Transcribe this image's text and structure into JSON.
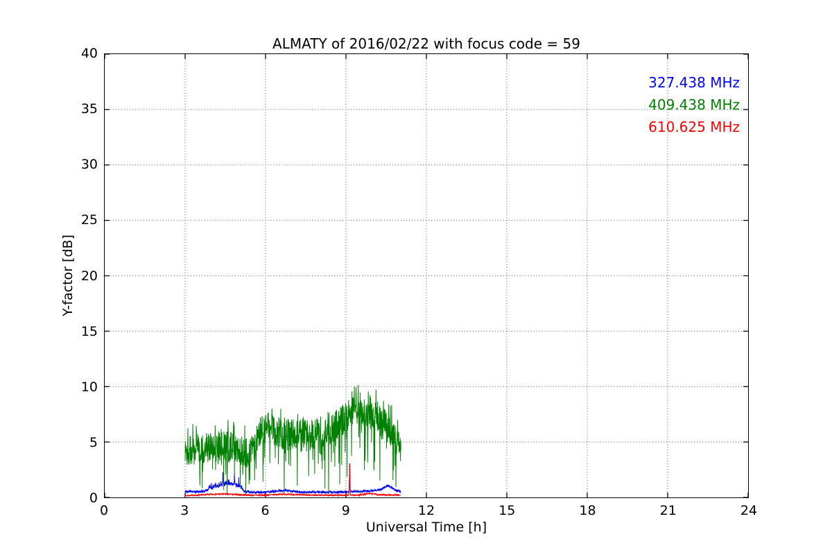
{
  "chart_data": {
    "type": "line",
    "title": "ALMATY of 2016/02/22 with focus code = 59",
    "xlabel": "Universal Time [h]",
    "ylabel": "Y-factor [dB]",
    "xlim": [
      0,
      24
    ],
    "ylim": [
      0,
      40
    ],
    "xticks": [
      0,
      3,
      6,
      9,
      12,
      15,
      18,
      21,
      24
    ],
    "yticks": [
      0,
      5,
      10,
      15,
      20,
      25,
      30,
      35,
      40
    ],
    "grid": "dotted",
    "legend": {
      "position": "upper-right",
      "entries": [
        {
          "label": "327.438 MHz",
          "color": "#0000ff"
        },
        {
          "label": "409.438 MHz",
          "color": "#008000"
        },
        {
          "label": "610.625 MHz",
          "color": "#ff0000"
        }
      ]
    },
    "series": [
      {
        "name": "327.438 MHz",
        "color": "#0000ff",
        "trange": [
          3.0,
          11.05
        ],
        "step": 0.008,
        "seed": 99,
        "noise": 0.22,
        "baseline": [
          [
            3.0,
            0.55
          ],
          [
            3.4,
            0.5
          ],
          [
            3.7,
            0.55
          ],
          [
            3.9,
            0.7
          ],
          [
            4.1,
            0.9
          ],
          [
            4.3,
            1.0
          ],
          [
            4.5,
            1.1
          ],
          [
            4.7,
            1.2
          ],
          [
            4.9,
            1.0
          ],
          [
            5.05,
            0.9
          ],
          [
            5.2,
            0.6
          ],
          [
            5.5,
            0.45
          ],
          [
            6.0,
            0.45
          ],
          [
            6.5,
            0.6
          ],
          [
            6.8,
            0.65
          ],
          [
            7.0,
            0.55
          ],
          [
            7.5,
            0.45
          ],
          [
            8.0,
            0.5
          ],
          [
            8.5,
            0.45
          ],
          [
            9.0,
            0.5
          ],
          [
            9.5,
            0.55
          ],
          [
            10.0,
            0.6
          ],
          [
            10.3,
            0.7
          ],
          [
            10.5,
            1.0
          ],
          [
            10.6,
            1.05
          ],
          [
            10.75,
            0.8
          ],
          [
            10.9,
            0.6
          ],
          [
            11.05,
            0.5
          ]
        ],
        "extra_noise": {
          "trange": [
            3.85,
            5.15
          ],
          "amp": 0.5
        },
        "spikes": [
          [
            3.9,
            1.3
          ],
          [
            4.41,
            2.5
          ],
          [
            4.67,
            1.5
          ],
          [
            4.84,
            2.2
          ],
          [
            5.0,
            1.8
          ],
          [
            9.14,
            3.7
          ]
        ],
        "spike_width": 0.022
      },
      {
        "name": "409.438 MHz",
        "color": "#008000",
        "trange": [
          3.0,
          11.05
        ],
        "step": 0.008,
        "seed": 1337,
        "band": 2.8,
        "dropout_prob": 0.1,
        "upspike_prob": 0.05,
        "ymax": 10.45,
        "center": [
          [
            3.0,
            4.2
          ],
          [
            3.5,
            4.4
          ],
          [
            4.0,
            4.5
          ],
          [
            4.5,
            4.7
          ],
          [
            5.0,
            4.4
          ],
          [
            5.4,
            3.9
          ],
          [
            5.8,
            5.8
          ],
          [
            6.1,
            6.4
          ],
          [
            6.4,
            5.9
          ],
          [
            6.8,
            5.6
          ],
          [
            7.2,
            5.7
          ],
          [
            7.6,
            5.6
          ],
          [
            8.0,
            5.9
          ],
          [
            8.4,
            6.1
          ],
          [
            8.8,
            6.9
          ],
          [
            9.2,
            7.6
          ],
          [
            9.5,
            7.9
          ],
          [
            9.8,
            7.3
          ],
          [
            10.1,
            7.5
          ],
          [
            10.4,
            6.9
          ],
          [
            10.7,
            5.9
          ],
          [
            10.9,
            4.9
          ],
          [
            11.05,
            4.3
          ]
        ]
      },
      {
        "name": "610.625 MHz",
        "color": "#ff0000",
        "trange": [
          3.0,
          11.05
        ],
        "step": 0.008,
        "seed": 7,
        "noise": 0.13,
        "baseline": [
          [
            3.0,
            0.15
          ],
          [
            3.5,
            0.2
          ],
          [
            4.0,
            0.28
          ],
          [
            4.5,
            0.3
          ],
          [
            5.0,
            0.25
          ],
          [
            5.5,
            0.2
          ],
          [
            6.0,
            0.2
          ],
          [
            6.7,
            0.3
          ],
          [
            7.0,
            0.25
          ],
          [
            8.0,
            0.2
          ],
          [
            9.0,
            0.2
          ],
          [
            9.5,
            0.22
          ],
          [
            9.9,
            0.35
          ],
          [
            10.2,
            0.25
          ],
          [
            10.6,
            0.22
          ],
          [
            11.05,
            0.2
          ]
        ],
        "spikes": [
          [
            9.14,
            3.45
          ]
        ],
        "spike_width": 0.028
      }
    ]
  }
}
